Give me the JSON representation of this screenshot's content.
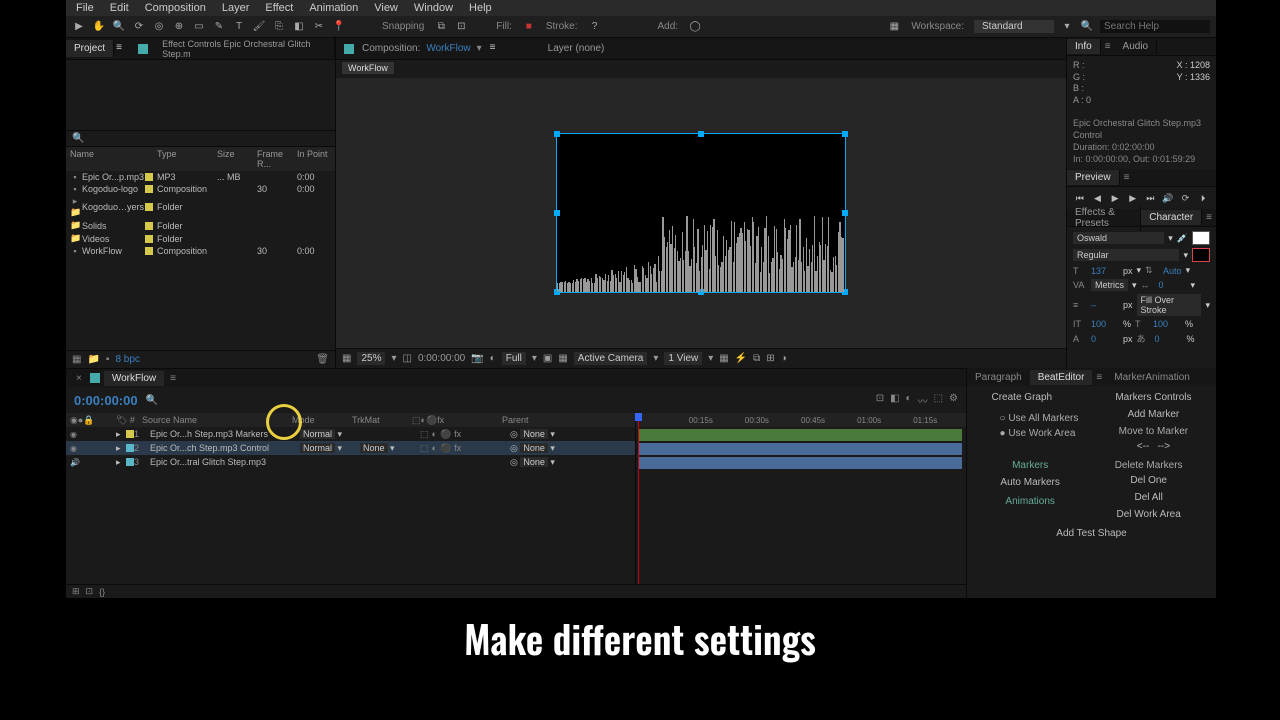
{
  "menu": [
    "File",
    "Edit",
    "Composition",
    "Layer",
    "Effect",
    "Animation",
    "View",
    "Window",
    "Help"
  ],
  "toolbar": {
    "snapping": "Snapping",
    "fill": "Fill:",
    "stroke": "Stroke:",
    "add": "Add:",
    "workspace_lbl": "Workspace:",
    "workspace": "Standard",
    "search_ph": "Search Help"
  },
  "project": {
    "tab": "Project",
    "effects_tab": "Effect Controls Epic Orchestral Glitch Step.m",
    "search_icon": "🔍",
    "columns": {
      "name": "Name",
      "type": "Type",
      "size": "Size",
      "fr": "Frame R...",
      "in": "In Point"
    },
    "items": [
      {
        "name": "Epic Or...p.mp3",
        "type": "MP3",
        "size": "... MB",
        "fr": "",
        "in": "0:00"
      },
      {
        "name": "Kogoduo-logo",
        "type": "Composition",
        "size": "",
        "fr": "30",
        "in": "0:00"
      },
      {
        "name": "Kogoduo…yers",
        "type": "Folder",
        "size": "",
        "fr": "",
        "in": ""
      },
      {
        "name": "Solids",
        "type": "Folder",
        "size": "",
        "fr": "",
        "in": ""
      },
      {
        "name": "Videos",
        "type": "Folder",
        "size": "",
        "fr": "",
        "in": ""
      },
      {
        "name": "WorkFlow",
        "type": "Composition",
        "size": "",
        "fr": "30",
        "in": "0:00"
      }
    ],
    "bpc": "8 bpc"
  },
  "comp": {
    "label": "Composition:",
    "name": "WorkFlow",
    "layer_lbl": "Layer (none)",
    "flow_chip": "WorkFlow",
    "footer": {
      "zoom": "25%",
      "time": "0:00:00:00",
      "res": "Full",
      "camera": "Active Camera",
      "views": "1 View"
    }
  },
  "info": {
    "tab_info": "Info",
    "tab_audio": "Audio",
    "r": "R :",
    "g": "G :",
    "b": "B :",
    "a": "A : 0",
    "x": "X : 1208",
    "y": "Y : 1336",
    "desc": "Epic Orchestral Glitch Step.mp3 Control",
    "dur": "Duration: 0:02:00:00",
    "inout": "In: 0:00:00:00, Out: 0:01:59:29"
  },
  "preview": {
    "tab": "Preview"
  },
  "effects_presets_tab": "Effects & Presets",
  "character": {
    "tab": "Character",
    "font": "Oswald",
    "style": "Regular",
    "size": "137",
    "px": "px",
    "lead": "Auto",
    "metrics": "Metrics",
    "tracking": "0",
    "vscale": "100",
    "hscale": "100",
    "pct": "%",
    "baseline": "0",
    "tsume": "0",
    "fillover": "Fill Over Stroke",
    "stroke_px": "px",
    "stroke_n": "–"
  },
  "timeline": {
    "tab": "WorkFlow",
    "timecode": "0:00:00:00",
    "cols": {
      "src": "Source Name",
      "mode": "Mode",
      "trk": "TrkMat",
      "parent": "Parent"
    },
    "layers": [
      {
        "n": "1",
        "name": "Epic Or...h Step.mp3 Markers",
        "mode": "Normal",
        "trk": "",
        "parent": "None"
      },
      {
        "n": "2",
        "name": "Epic Or...ch Step.mp3 Control",
        "mode": "Normal",
        "trk": "None",
        "parent": "None"
      },
      {
        "n": "3",
        "name": "Epic Or...tral Glitch Step.mp3",
        "mode": "",
        "trk": "",
        "parent": "None"
      }
    ],
    "ruler": [
      "00:15s",
      "00:30s",
      "00:45s",
      "01:00s",
      "01:15s"
    ]
  },
  "beat": {
    "tab_para": "Paragraph",
    "tab_beat": "BeatEditor",
    "tab_marker": "MarkerAnimation",
    "create_graph": "Create Graph",
    "markers_controls": "Markers Controls",
    "use_all": "Use All Markers",
    "use_wa": "Use Work Area",
    "add_marker": "Add Marker",
    "move_to": "Move to Marker",
    "prev": "<--",
    "next": "-->",
    "markers": "Markers",
    "auto_markers": "Auto Markers",
    "animations": "Animations",
    "del_markers": "Delete Markers",
    "del_one": "Del One",
    "del_all": "Del All",
    "del_wa": "Del Work Area",
    "add_test": "Add Test Shape"
  },
  "caption": "Make different settings"
}
